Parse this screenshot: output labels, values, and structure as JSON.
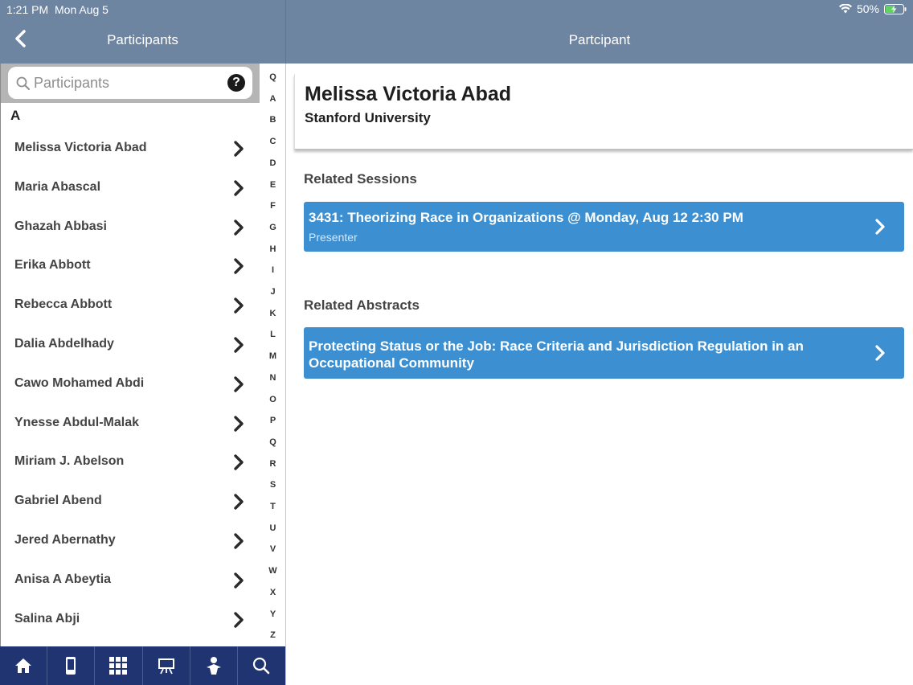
{
  "status_bar": {
    "time": "1:21 PM",
    "date": "Mon Aug 5",
    "battery": "50%"
  },
  "header": {
    "left_title": "Participants",
    "right_title": "Partcipant"
  },
  "search": {
    "placeholder": "Participants"
  },
  "list": {
    "section_letter": "A",
    "items": [
      {
        "label": "Melissa Victoria Abad"
      },
      {
        "label": "Maria Abascal"
      },
      {
        "label": "Ghazah Abbasi"
      },
      {
        "label": "Erika Abbott"
      },
      {
        "label": "Rebecca Abbott"
      },
      {
        "label": "Dalia Abdelhady"
      },
      {
        "label": "Cawo Mohamed Abdi"
      },
      {
        "label": "Ynesse Abdul-Malak"
      },
      {
        "label": "Miriam J. Abelson"
      },
      {
        "label": "Gabriel Abend"
      },
      {
        "label": "Jered Abernathy"
      },
      {
        "label": "Anisa A Abeytia"
      },
      {
        "label": "Salina Abji"
      }
    ]
  },
  "index_letters": [
    "Q",
    "A",
    "B",
    "C",
    "D",
    "E",
    "F",
    "G",
    "H",
    "I",
    "J",
    "K",
    "L",
    "M",
    "N",
    "O",
    "P",
    "Q",
    "R",
    "S",
    "T",
    "U",
    "V",
    "W",
    "X",
    "Y",
    "Z"
  ],
  "tabbar": {
    "tabs": [
      "home-icon",
      "phone-icon",
      "grid-icon",
      "presentation-icon",
      "person-icon",
      "search-icon"
    ]
  },
  "participant": {
    "name": "Melissa Victoria Abad",
    "organization": "Stanford University",
    "related_sessions_title": "Related Sessions",
    "session": {
      "title": "3431: Theorizing Race in Organizations @ Monday, Aug 12 2:30 PM",
      "role": "Presenter"
    },
    "related_abstracts_title": "Related Abstracts",
    "abstract": {
      "line1": "Protecting Status or the Job: Race Criteria and Jurisdiction Regulation in an",
      "line2": "Occupational Community"
    }
  },
  "colors": {
    "header": "#6e85a1",
    "tabbar": "#1f3470",
    "card": "#3c8fd0"
  }
}
